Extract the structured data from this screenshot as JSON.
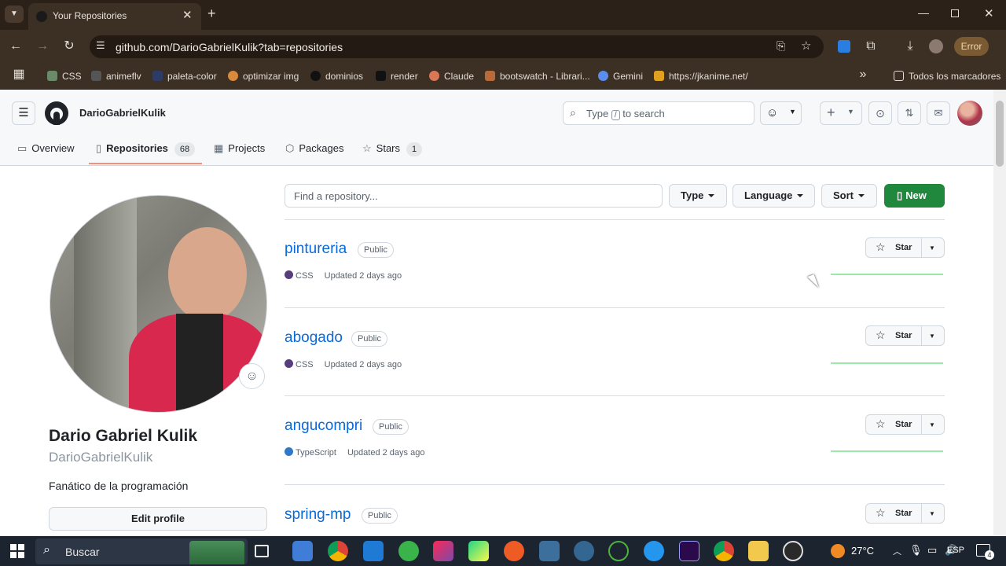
{
  "browser": {
    "tab_title": "Your Repositories",
    "url": "github.com/DarioGabrielKulik?tab=repositories",
    "error_label": "Error",
    "bookmarks": [
      "CSS",
      "animeflv",
      "paleta-color",
      "optimizar img",
      "dominios",
      "render",
      "Claude",
      "bootswatch - Librari...",
      "Gemini",
      "https://jkanime.net/"
    ],
    "all_bookmarks": "Todos los marcadores"
  },
  "header": {
    "username": "DarioGabrielKulik",
    "search_pre": "Type",
    "search_key": "/",
    "search_post": "to search"
  },
  "nav": {
    "overview": "Overview",
    "repositories": "Repositories",
    "repositories_count": "68",
    "projects": "Projects",
    "packages": "Packages",
    "stars": "Stars",
    "stars_count": "1"
  },
  "profile": {
    "name": "Dario Gabriel Kulik",
    "login": "DarioGabrielKulik",
    "bio": "Fanático de la programación",
    "edit_label": "Edit profile"
  },
  "filters": {
    "find_placeholder": "Find a repository...",
    "type": "Type",
    "language": "Language",
    "sort": "Sort",
    "new": "New"
  },
  "repos": [
    {
      "name": "pintureria",
      "visibility": "Public",
      "language": "CSS",
      "lang_color": "#563d7c",
      "updated": "Updated 2 days ago",
      "star_label": "Star"
    },
    {
      "name": "abogado",
      "visibility": "Public",
      "language": "CSS",
      "lang_color": "#563d7c",
      "updated": "Updated 2 days ago",
      "star_label": "Star"
    },
    {
      "name": "angucompri",
      "visibility": "Public",
      "language": "TypeScript",
      "lang_color": "#3178c6",
      "updated": "Updated 2 days ago",
      "star_label": "Star"
    },
    {
      "name": "spring-mp",
      "visibility": "Public",
      "star_label": "Star"
    }
  ],
  "taskbar": {
    "search": "Buscar",
    "temperature": "27°C",
    "lang": "ESP",
    "notif_count": "4"
  },
  "colors": {
    "accent": "#0969da",
    "new_button": "#1f883d",
    "nav_underline": "#fd8c73"
  }
}
